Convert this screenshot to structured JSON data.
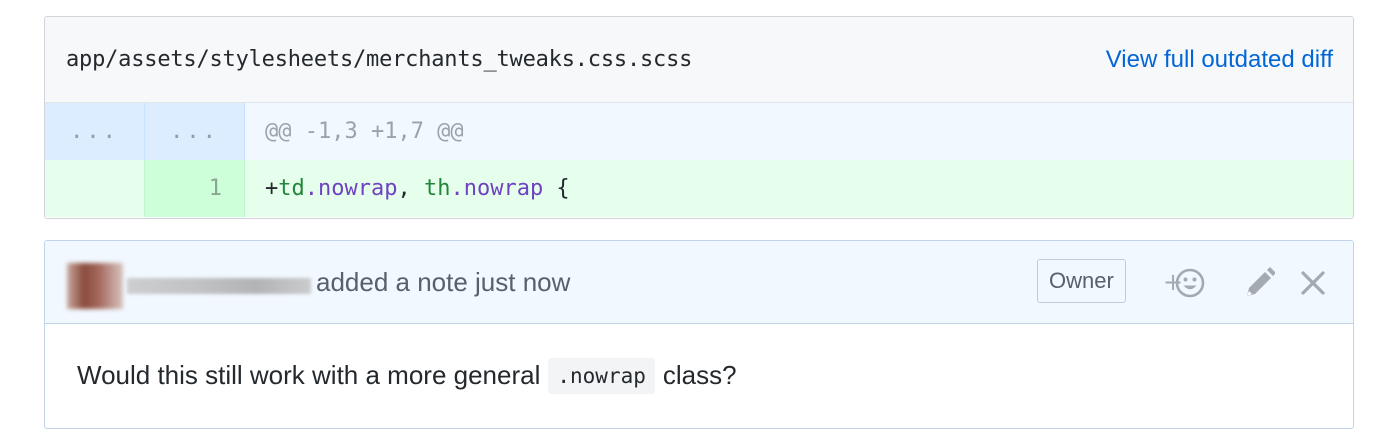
{
  "file": {
    "path": "app/assets/stylesheets/merchants_tweaks.css.scss",
    "view_link": "View full outdated diff"
  },
  "diff": {
    "hunk": {
      "old_num": "...",
      "new_num": "...",
      "text": "@@ -1,3 +1,7 @@"
    },
    "lines": [
      {
        "old_num": "",
        "new_num": "1",
        "tokens": [
          "+",
          "td",
          ".nowrap",
          ", ",
          "th",
          ".nowrap",
          " {"
        ]
      }
    ]
  },
  "comment": {
    "action_text": "added a note just now",
    "owner_badge": "Owner",
    "body_before": "Would this still work with a more general",
    "body_code": ".nowrap",
    "body_after": "class?",
    "icons": [
      "add-reaction-icon",
      "pencil-icon",
      "close-icon"
    ]
  },
  "colors": {
    "link": "#0366d6",
    "added_bg": "#e6ffed",
    "hunk_bg": "#f1f8ff"
  }
}
